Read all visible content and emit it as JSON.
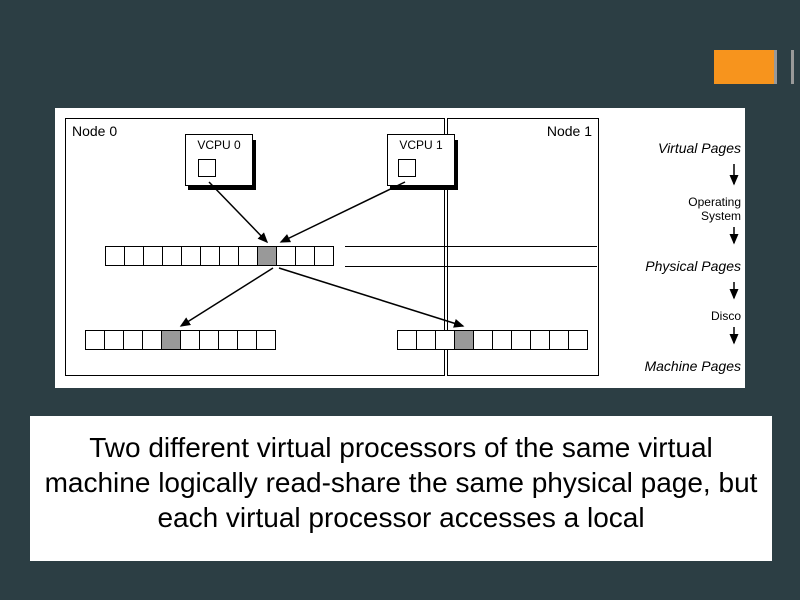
{
  "decor": {
    "color": "#f7941d"
  },
  "diagram": {
    "nodes": [
      {
        "id": 0,
        "label": "Node 0"
      },
      {
        "id": 1,
        "label": "Node 1"
      }
    ],
    "vcpus": [
      {
        "id": 0,
        "label": "VCPU 0",
        "node": 0
      },
      {
        "id": 1,
        "label": "VCPU 1",
        "node": 1
      }
    ],
    "physical_row": {
      "cells": 12,
      "selected_index": 8,
      "spans_nodes": true
    },
    "machine_rows": [
      {
        "node": 0,
        "cells": 10,
        "selected_index": 4
      },
      {
        "node": 1,
        "cells": 10,
        "selected_index": 3
      }
    ],
    "side_labels": {
      "virtual": "Virtual Pages",
      "os": "Operating\nSystem",
      "physical": "Physical Pages",
      "disco": "Disco",
      "machine": "Machine Pages"
    },
    "mappings": [
      {
        "from": "vcpu0-cell",
        "to": "physical-selected"
      },
      {
        "from": "vcpu1-cell",
        "to": "physical-selected"
      },
      {
        "from": "physical-selected",
        "to": "machine0-selected"
      },
      {
        "from": "physical-selected",
        "to": "machine1-selected"
      }
    ]
  },
  "caption": "Two different virtual processors of the same virtual machine logically read-share the same physical page, but each virtual processor accesses a local"
}
